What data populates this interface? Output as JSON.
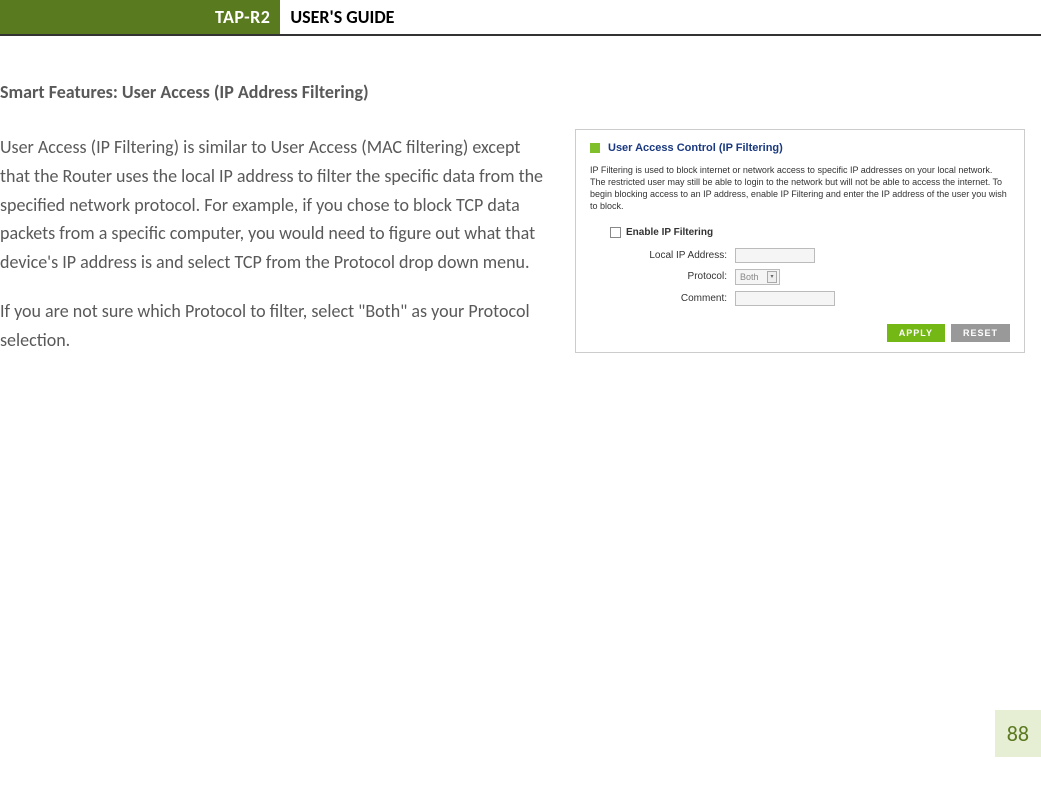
{
  "header": {
    "product": "TAP-R2",
    "title": "USER'S GUIDE"
  },
  "section_title": "Smart Features: User Access (IP Address Filtering)",
  "paragraph1": "User Access (IP Filtering) is similar to User Access (MAC filtering) except that the Router uses the local IP address to filter the specific data from the specified network protocol. For example, if you chose to block TCP data packets from a specific computer, you would need to figure out what that device's IP address is and select TCP from the Protocol drop down menu.",
  "paragraph2": "If you are not sure which Protocol to filter, select \"Both\" as your Protocol selection.",
  "panel": {
    "title": "User Access Control (IP Filtering)",
    "description": "IP Filtering is used to block internet or network access to specific IP addresses on your local network. The restricted user may still be able to login to the network but will not be able to access the internet. To begin blocking access to an IP address, enable IP Filtering and enter the IP address of the user you wish to block.",
    "checkbox_label": "Enable IP Filtering",
    "rows": {
      "ip_label": "Local IP Address:",
      "protocol_label": "Protocol:",
      "protocol_value": "Both",
      "comment_label": "Comment:"
    },
    "buttons": {
      "apply": "APPLY",
      "reset": "RESET"
    }
  },
  "page_number": "88"
}
